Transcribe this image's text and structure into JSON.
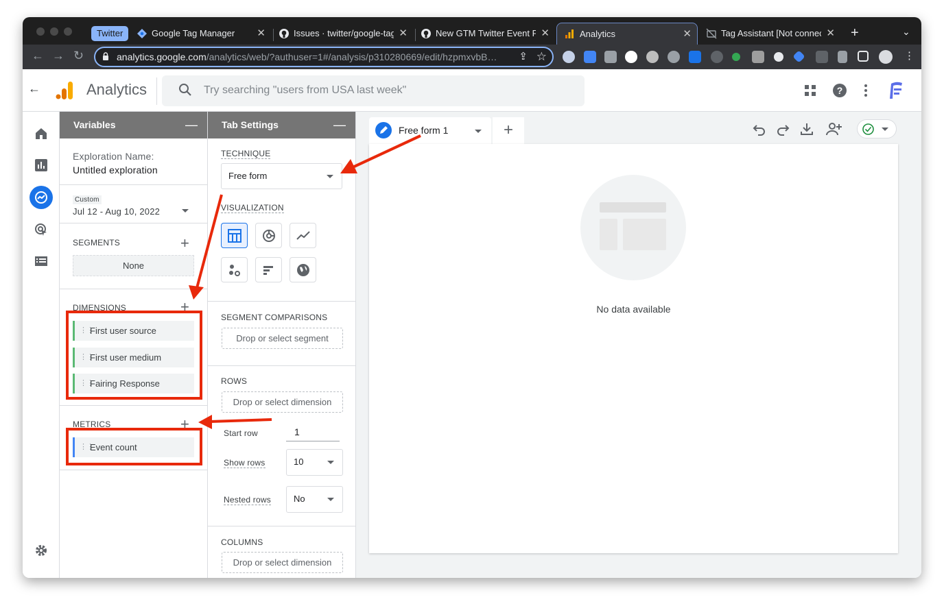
{
  "browser": {
    "twitter_chip": "Twitter",
    "tabs": [
      {
        "title": "Google Tag Manager",
        "icon": "gtm-icon"
      },
      {
        "title": "Issues · twitter/google-tag",
        "icon": "github-icon"
      },
      {
        "title": "New GTM Twitter Event Pi",
        "icon": "github-icon"
      },
      {
        "title": "Analytics",
        "icon": "analytics-icon"
      },
      {
        "title": "Tag Assistant [Not connec",
        "icon": "tag-assistant-icon"
      }
    ],
    "url_host": "analytics.google.com",
    "url_path": "/analytics/web/?authuser=1#/analysis/p310280669/edit/hzpmxvbB…"
  },
  "app": {
    "title": "Analytics",
    "search_placeholder": "Try searching \"users from USA last week\""
  },
  "variables": {
    "header": "Variables",
    "exploration_label": "Exploration Name:",
    "exploration_name": "Untitled exploration",
    "date_tag": "Custom",
    "date_range": "Jul 12 - Aug 10, 2022",
    "segments_label": "SEGMENTS",
    "segments_value": "None",
    "dimensions_label": "DIMENSIONS",
    "dimensions": [
      "First user source",
      "First user medium",
      "Fairing Response"
    ],
    "metrics_label": "METRICS",
    "metrics": [
      "Event count"
    ]
  },
  "tab_settings": {
    "header": "Tab Settings",
    "technique_label": "TECHNIQUE",
    "technique_value": "Free form",
    "visualization_label": "VISUALIZATION",
    "segment_comparisons_label": "SEGMENT COMPARISONS",
    "segment_drop": "Drop or select segment",
    "rows_label": "ROWS",
    "rows_drop": "Drop or select dimension",
    "start_row_label": "Start row",
    "start_row_value": "1",
    "show_rows_label": "Show rows",
    "show_rows_value": "10",
    "nested_rows_label": "Nested rows",
    "nested_rows_value": "No",
    "columns_label": "COLUMNS",
    "columns_drop": "Drop or select dimension"
  },
  "canvas": {
    "tab_name": "Free form 1",
    "empty_text": "No data available"
  },
  "colors": {
    "accent": "#1a73e8",
    "annotation": "#e8290b",
    "panel_header": "#757575"
  }
}
